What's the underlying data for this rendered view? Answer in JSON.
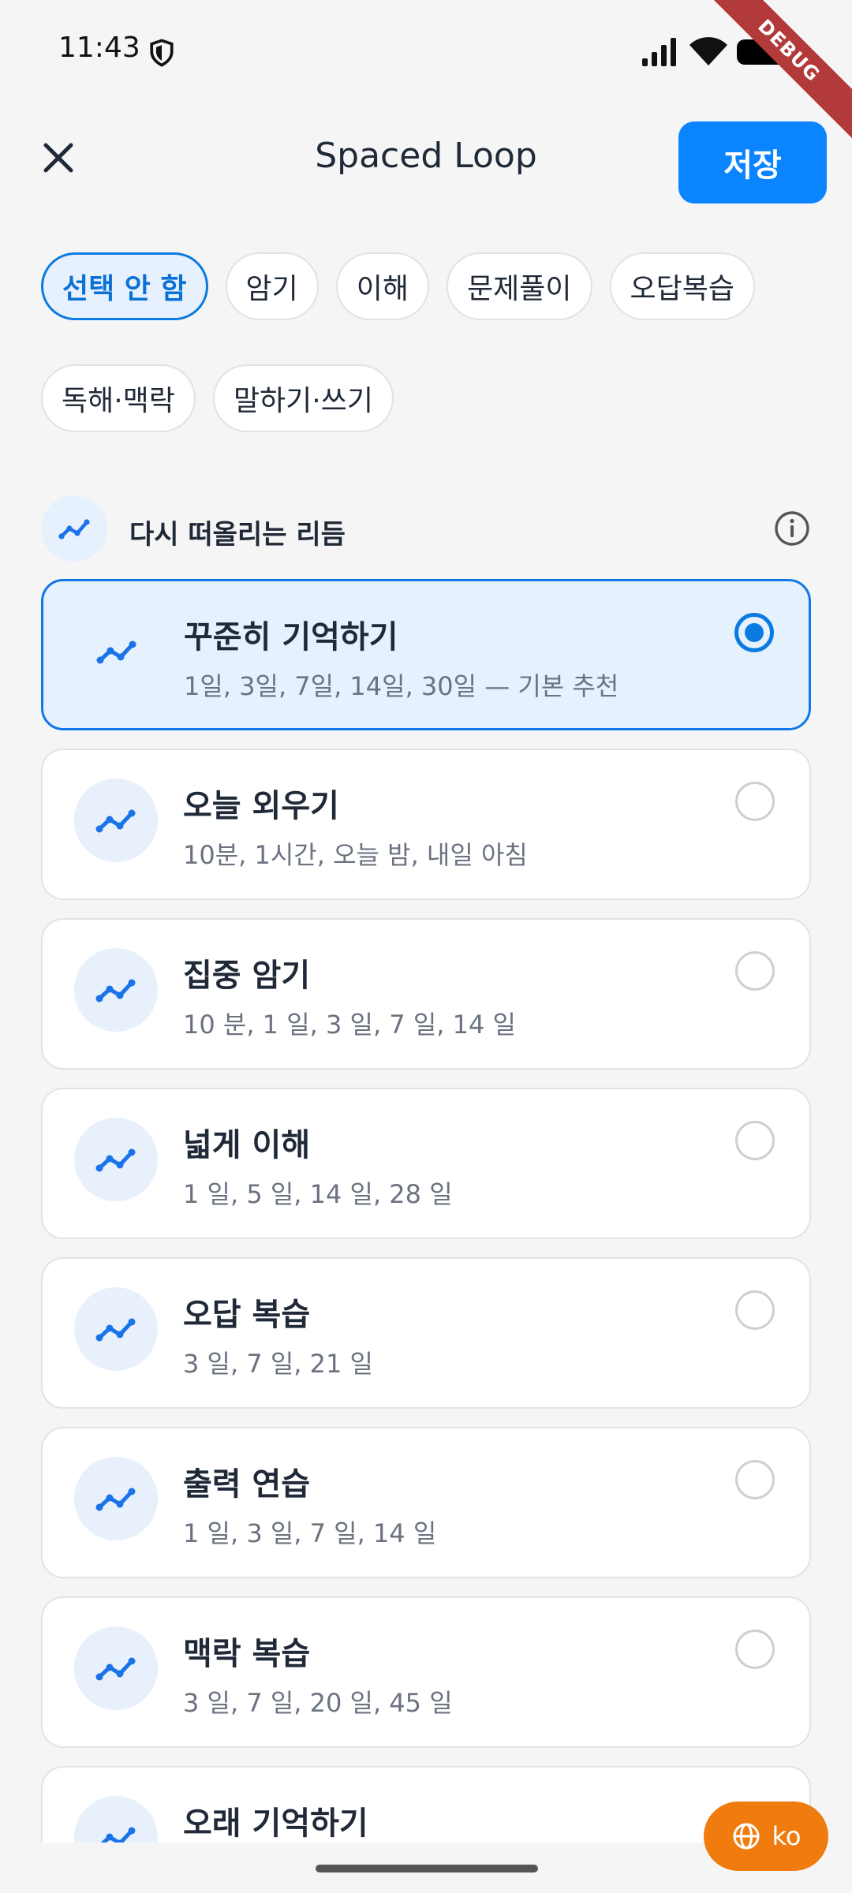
{
  "status": {
    "time": "11:43",
    "debug": "DEBUG"
  },
  "appbar": {
    "title": "Spaced Loop",
    "save_label": "저장"
  },
  "chips": [
    {
      "label": "선택 안 함",
      "selected": true
    },
    {
      "label": "암기",
      "selected": false
    },
    {
      "label": "이해",
      "selected": false
    },
    {
      "label": "문제풀이",
      "selected": false
    },
    {
      "label": "오답복습",
      "selected": false
    },
    {
      "label": "독해·맥락",
      "selected": false
    },
    {
      "label": "말하기·쓰기",
      "selected": false
    }
  ],
  "section": {
    "label": "다시 떠올리는 리듬"
  },
  "rhythms": [
    {
      "title": "꾸준히 기억하기",
      "subtitle": "1일, 3일, 7일, 14일, 30일 — 기본 추천",
      "selected": true
    },
    {
      "title": "오늘 외우기",
      "subtitle": "10분, 1시간, 오늘 밤, 내일 아침",
      "selected": false
    },
    {
      "title": "집중 암기",
      "subtitle": "10 분, 1 일, 3 일, 7 일, 14 일",
      "selected": false
    },
    {
      "title": "넓게 이해",
      "subtitle": "1 일, 5 일, 14 일, 28 일",
      "selected": false
    },
    {
      "title": "오답 복습",
      "subtitle": "3 일, 7 일, 21 일",
      "selected": false
    },
    {
      "title": "출력 연습",
      "subtitle": "1 일, 3 일, 7 일, 14 일",
      "selected": false
    },
    {
      "title": "맥락 복습",
      "subtitle": "3 일, 7 일, 20 일, 45 일",
      "selected": false
    },
    {
      "title": "오래 기억하기",
      "subtitle": "",
      "selected": false
    }
  ],
  "fab": {
    "label": "ko"
  },
  "colors": {
    "accent": "#0a84ff",
    "fab": "#f07b0f"
  }
}
